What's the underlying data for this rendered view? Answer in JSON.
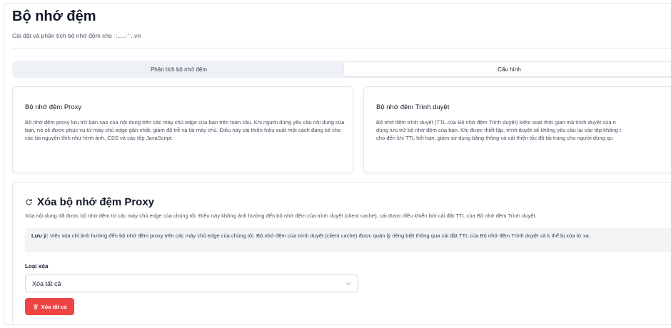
{
  "header": {
    "title": "Bộ nhớ đệm",
    "subtitle": "Cài đặt và phân tích bộ nhớ đệm cho ·:.....·'·..vn"
  },
  "tabs": [
    {
      "label": "Phân tích bộ nhớ đệm",
      "active": false
    },
    {
      "label": "Cấu hình",
      "active": true
    }
  ],
  "cards": {
    "proxy": {
      "title": "Bộ nhớ đệm Proxy",
      "text": "Bộ nhớ đệm proxy lưu trữ bản sao của nội dung trên các máy chủ edge của bạn trên toàn cầu. Khi người dùng yêu cầu nội dung của bạn, nó sẽ được phục vụ từ máy chủ edge gần nhất, giảm độ trễ và tải máy chủ. Điều này cải thiện hiệu suất một cách đáng kể cho các tài nguyên tĩnh như hình ảnh, CSS và các tệp JavaScript."
    },
    "browser": {
      "title": "Bộ nhớ đệm Trình duyệt",
      "line1": "Bộ nhớ đệm trình duyệt (TTL của Bộ nhớ đệm Trình duyệt) kiểm soát thời gian mà trình duyệt của n",
      "line2": "dùng lưu trữ bộ nhớ đệm của bạn. Khi được thiết lập, trình duyệt sẽ không yêu cầu lại các tệp không t",
      "line3": "cho đến khi TTL hết hạn, giảm sử dụng băng thông và cải thiện tốc độ tải trang cho người dùng qu"
    }
  },
  "purge": {
    "title": "Xóa bộ nhớ đệm Proxy",
    "description": "Xóa nội dung đã được bộ nhớ đệm từ các máy chủ edge của chúng tôi. Điều này không ảnh hưởng đến bộ nhớ đệm của trình duyệt (client cache), cái được điều khiển bởi cài đặt TTL của Bộ nhớ đệm Trình duyệt.",
    "note_label": "Lưu ý:",
    "note_text": " Việc xóa chỉ ảnh hưởng đến bộ nhớ đệm proxy trên các máy chủ edge của chúng tôi. Bộ nhớ đệm của trình duyệt (client cache) được quản lý riêng biệt thông qua cài đặt TTL của Bộ nhớ đệm Trình duyệt và k thể bị xóa từ xa.",
    "field_label": "Loại xóa",
    "select_value": "Xóa tất cả",
    "button_label": "Xóa tất cả"
  },
  "icons": {
    "refresh": "refresh-icon",
    "chevron": "chevron-down-icon",
    "trash": "trash-icon"
  },
  "colors": {
    "danger": "#ef4444",
    "tab_bg": "#eef1f5",
    "note_bg": "#f3f4f6"
  }
}
